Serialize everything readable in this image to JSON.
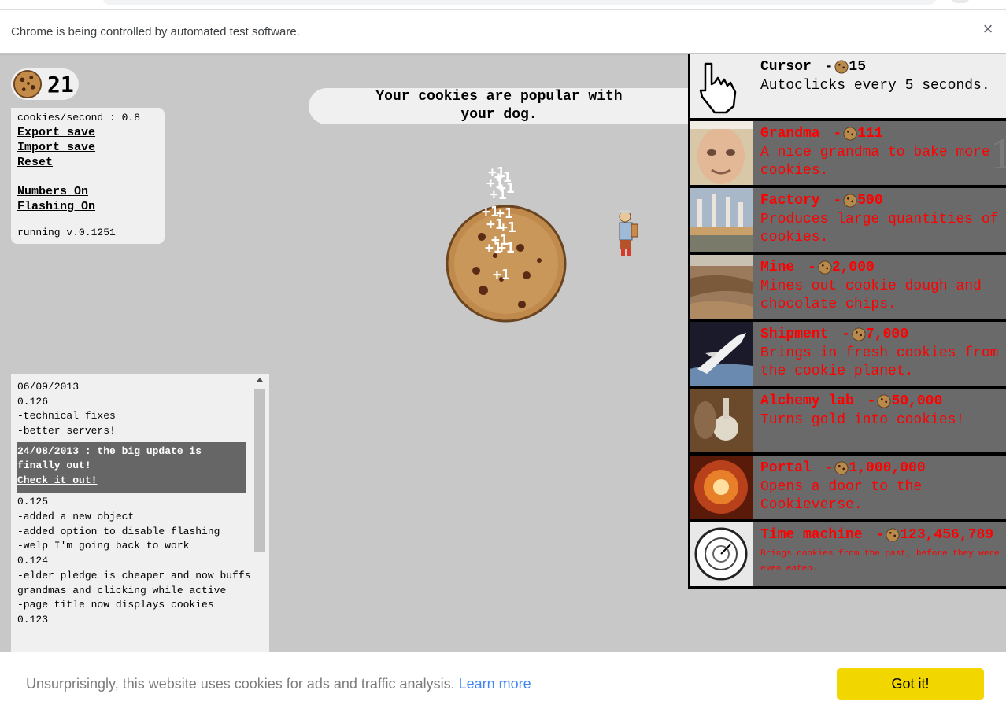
{
  "infobar": {
    "message": "Chrome is being controlled by automated test software.",
    "close_glyph": "×"
  },
  "game": {
    "cookie_count": "21",
    "stats": {
      "cps": "cookies/second : 0.8",
      "export": "Export save",
      "import": "Import save",
      "reset": "Reset",
      "numbers": "Numbers On",
      "flashing": "Flashing On",
      "version": "running v.0.1251"
    },
    "news": "Your cookies are popular with your dog.",
    "particle_text": "+1",
    "updates": {
      "lines_a": [
        "06/09/2013",
        "0.126",
        "-technical fixes",
        "-better servers!"
      ],
      "highlight": "24/08/2013 : the big update is finally out!",
      "highlight_link": "Check it out!",
      "lines_b": [
        "0.125",
        "-added a new object",
        "-added option to disable flashing",
        "-welp I'm going back to work",
        "0.124",
        "-elder pledge is cheaper and now buffs grandmas and clicking while active",
        "-page title now displays cookies",
        "0.123"
      ]
    },
    "store": [
      {
        "name": "Cursor",
        "price": "15",
        "desc": "Autoclicks every 5 seconds.",
        "icon": "cursor-icon",
        "affordable": true
      },
      {
        "name": "Grandma",
        "price": "111",
        "desc": "A nice grandma to bake more cookies.",
        "icon": "grandma-icon",
        "owned": "1"
      },
      {
        "name": "Factory",
        "price": "500",
        "desc": "Produces large quantities of cookies.",
        "icon": "factory-icon"
      },
      {
        "name": "Mine",
        "price": "2,000",
        "desc": "Mines out cookie dough and chocolate chips.",
        "icon": "mine-icon"
      },
      {
        "name": "Shipment",
        "price": "7,000",
        "desc": "Brings in fresh cookies from the cookie planet.",
        "icon": "shipment-icon"
      },
      {
        "name": "Alchemy lab",
        "price": "50,000",
        "desc": "Turns gold into cookies!",
        "icon": "alchemy-icon"
      },
      {
        "name": "Portal",
        "price": "1,000,000",
        "desc": "Opens a door to the Cookieverse.",
        "icon": "portal-icon"
      },
      {
        "name": "Time machine",
        "price": "123,456,789",
        "desc": "Brings cookies from the past, before they were even eaten.",
        "icon": "time-machine-icon"
      }
    ]
  },
  "consent": {
    "text": "Unsurprisingly, this website uses cookies for ads and traffic analysis.",
    "link": "Learn more",
    "button": "Got it!"
  },
  "colors": {
    "store_locked_text": "#ff0000",
    "store_locked_bg": "#6a6a6a",
    "consent_button": "#f1d600",
    "consent_link": "#4286f4"
  }
}
